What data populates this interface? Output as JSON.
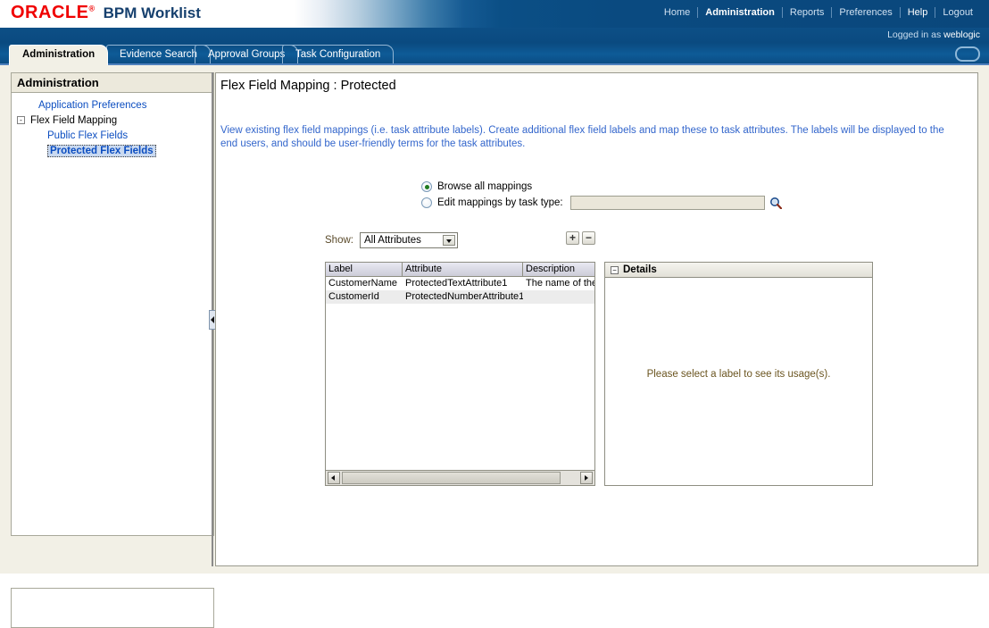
{
  "brand": {
    "oracle": "ORACLE",
    "trademark": "®",
    "app_title": "BPM Worklist"
  },
  "top_nav": {
    "items": [
      {
        "label": "Home",
        "current": false
      },
      {
        "label": "Administration",
        "current": true
      },
      {
        "label": "Reports",
        "current": false
      },
      {
        "label": "Preferences",
        "current": false
      },
      {
        "label": "Help",
        "current": false
      },
      {
        "label": "Logout",
        "current": false
      }
    ]
  },
  "session": {
    "logged_in_prefix": "Logged in as ",
    "user": "weblogic"
  },
  "tabs": [
    {
      "label": "Administration",
      "active": true
    },
    {
      "label": "Evidence Search",
      "active": false
    },
    {
      "label": "Approval Groups",
      "active": false
    },
    {
      "label": "Task Configuration",
      "active": false
    }
  ],
  "sidebar": {
    "header": "Administration",
    "tree": [
      {
        "label": "Application Preferences",
        "level": 1,
        "link": true,
        "selected": false,
        "expander": null
      },
      {
        "label": "Flex Field Mapping",
        "level": 1,
        "link": false,
        "selected": false,
        "expander": "-"
      },
      {
        "label": "Public Flex Fields",
        "level": 2,
        "link": true,
        "selected": false,
        "expander": null
      },
      {
        "label": "Protected Flex Fields",
        "level": 2,
        "link": true,
        "selected": true,
        "expander": null
      }
    ]
  },
  "content": {
    "title": "Flex Field Mapping : Protected",
    "description": "View existing flex field mappings (i.e. task attribute labels). Create additional flex field labels and map these to task attributes. The labels will be displayed to the end users, and should be user-friendly terms for the task attributes."
  },
  "mode": {
    "browse_label": "Browse all mappings",
    "browse_selected": true,
    "edit_label": "Edit mappings by task type:",
    "edit_selected": false,
    "task_type_value": "",
    "task_type_placeholder": "",
    "search_icon": "magnifier-icon"
  },
  "toolbar": {
    "show_label": "Show:",
    "show_value": "All Attributes",
    "show_options": [
      "All Attributes"
    ],
    "add_label": "+",
    "remove_label": "−"
  },
  "table": {
    "columns": [
      "Label",
      "Attribute",
      "Description"
    ],
    "rows": [
      {
        "label": "CustomerName",
        "attribute": "ProtectedTextAttribute1",
        "description": "The name of the "
      },
      {
        "label": "CustomerId",
        "attribute": "ProtectedNumberAttribute1",
        "description": ""
      }
    ]
  },
  "details": {
    "title": "Details",
    "empty_message": "Please select a label to see its usage(s)."
  },
  "colors": {
    "brand_red": "#f00000",
    "brand_blue": "#0a4a80",
    "link_blue": "#3366cc",
    "selected_bg": "#c9d9f0",
    "panel_bg": "#f2f0e6",
    "detail_text": "#6b5520"
  }
}
